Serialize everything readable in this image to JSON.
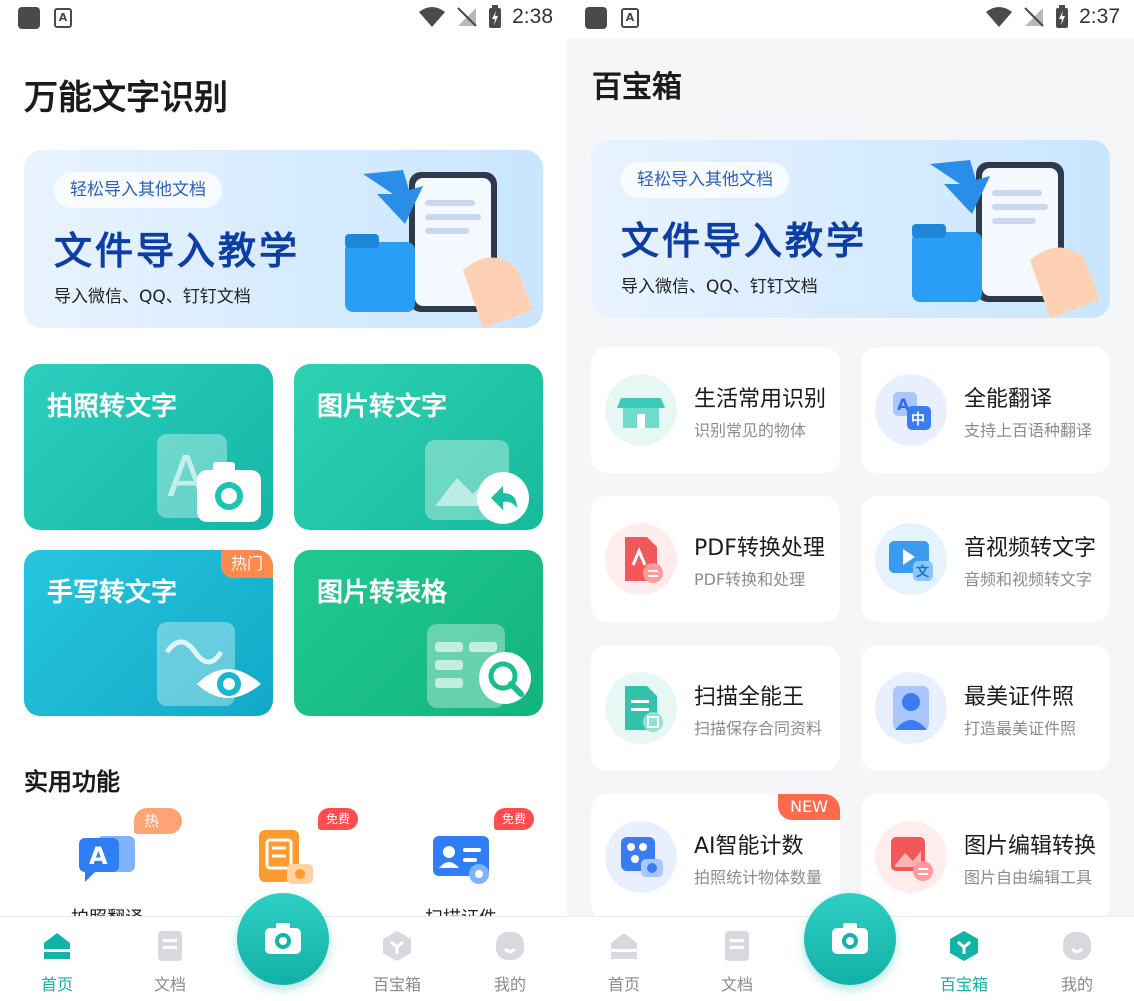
{
  "status_left": {
    "time": "2:38"
  },
  "status_right": {
    "time": "2:37"
  },
  "home": {
    "title": "万能文字识别",
    "banner": {
      "pill": "轻松导入其他文档",
      "title": "文件导入教学",
      "subtitle": "导入微信、QQ、钉钉文档"
    },
    "features": [
      {
        "label": "拍照转文字",
        "color": "#1cc4b3"
      },
      {
        "label": "图片转文字",
        "color": "#1ac0a4"
      },
      {
        "label": "手写转文字",
        "color": "#19b7cf",
        "tag": "热门"
      },
      {
        "label": "图片转表格",
        "color": "#17bf8b"
      }
    ],
    "section_title": "实用功能",
    "tools": [
      {
        "label": "拍照翻译",
        "tag": "热门"
      },
      {
        "label": "",
        "tag": "免费"
      },
      {
        "label": "扫描证件",
        "tag": "免费"
      }
    ]
  },
  "toolbox": {
    "title": "百宝箱",
    "banner": {
      "pill": "轻松导入其他文档",
      "title": "文件导入教学",
      "subtitle": "导入微信、QQ、钉钉文档"
    },
    "cards": [
      {
        "title": "生活常用识别",
        "subtitle": "识别常见的物体"
      },
      {
        "title": "全能翻译",
        "subtitle": "支持上百语种翻译"
      },
      {
        "title": "PDF转换处理",
        "subtitle": "PDF转换和处理"
      },
      {
        "title": "音视频转文字",
        "subtitle": "音频和视频转文字"
      },
      {
        "title": "扫描全能王",
        "subtitle": "扫描保存合同资料"
      },
      {
        "title": "最美证件照",
        "subtitle": "打造最美证件照"
      },
      {
        "title": "AI智能计数",
        "subtitle": "拍照统计物体数量",
        "tag": "NEW"
      },
      {
        "title": "图片编辑转换",
        "subtitle": "图片自由编辑工具"
      }
    ]
  },
  "tabs": [
    "首页",
    "文档",
    "百宝箱",
    "我的"
  ],
  "colors": {
    "accent": "#11b3a6",
    "hot": "#ff8a4c",
    "free": "#ff4d4f",
    "new": "#ff6a4d"
  }
}
